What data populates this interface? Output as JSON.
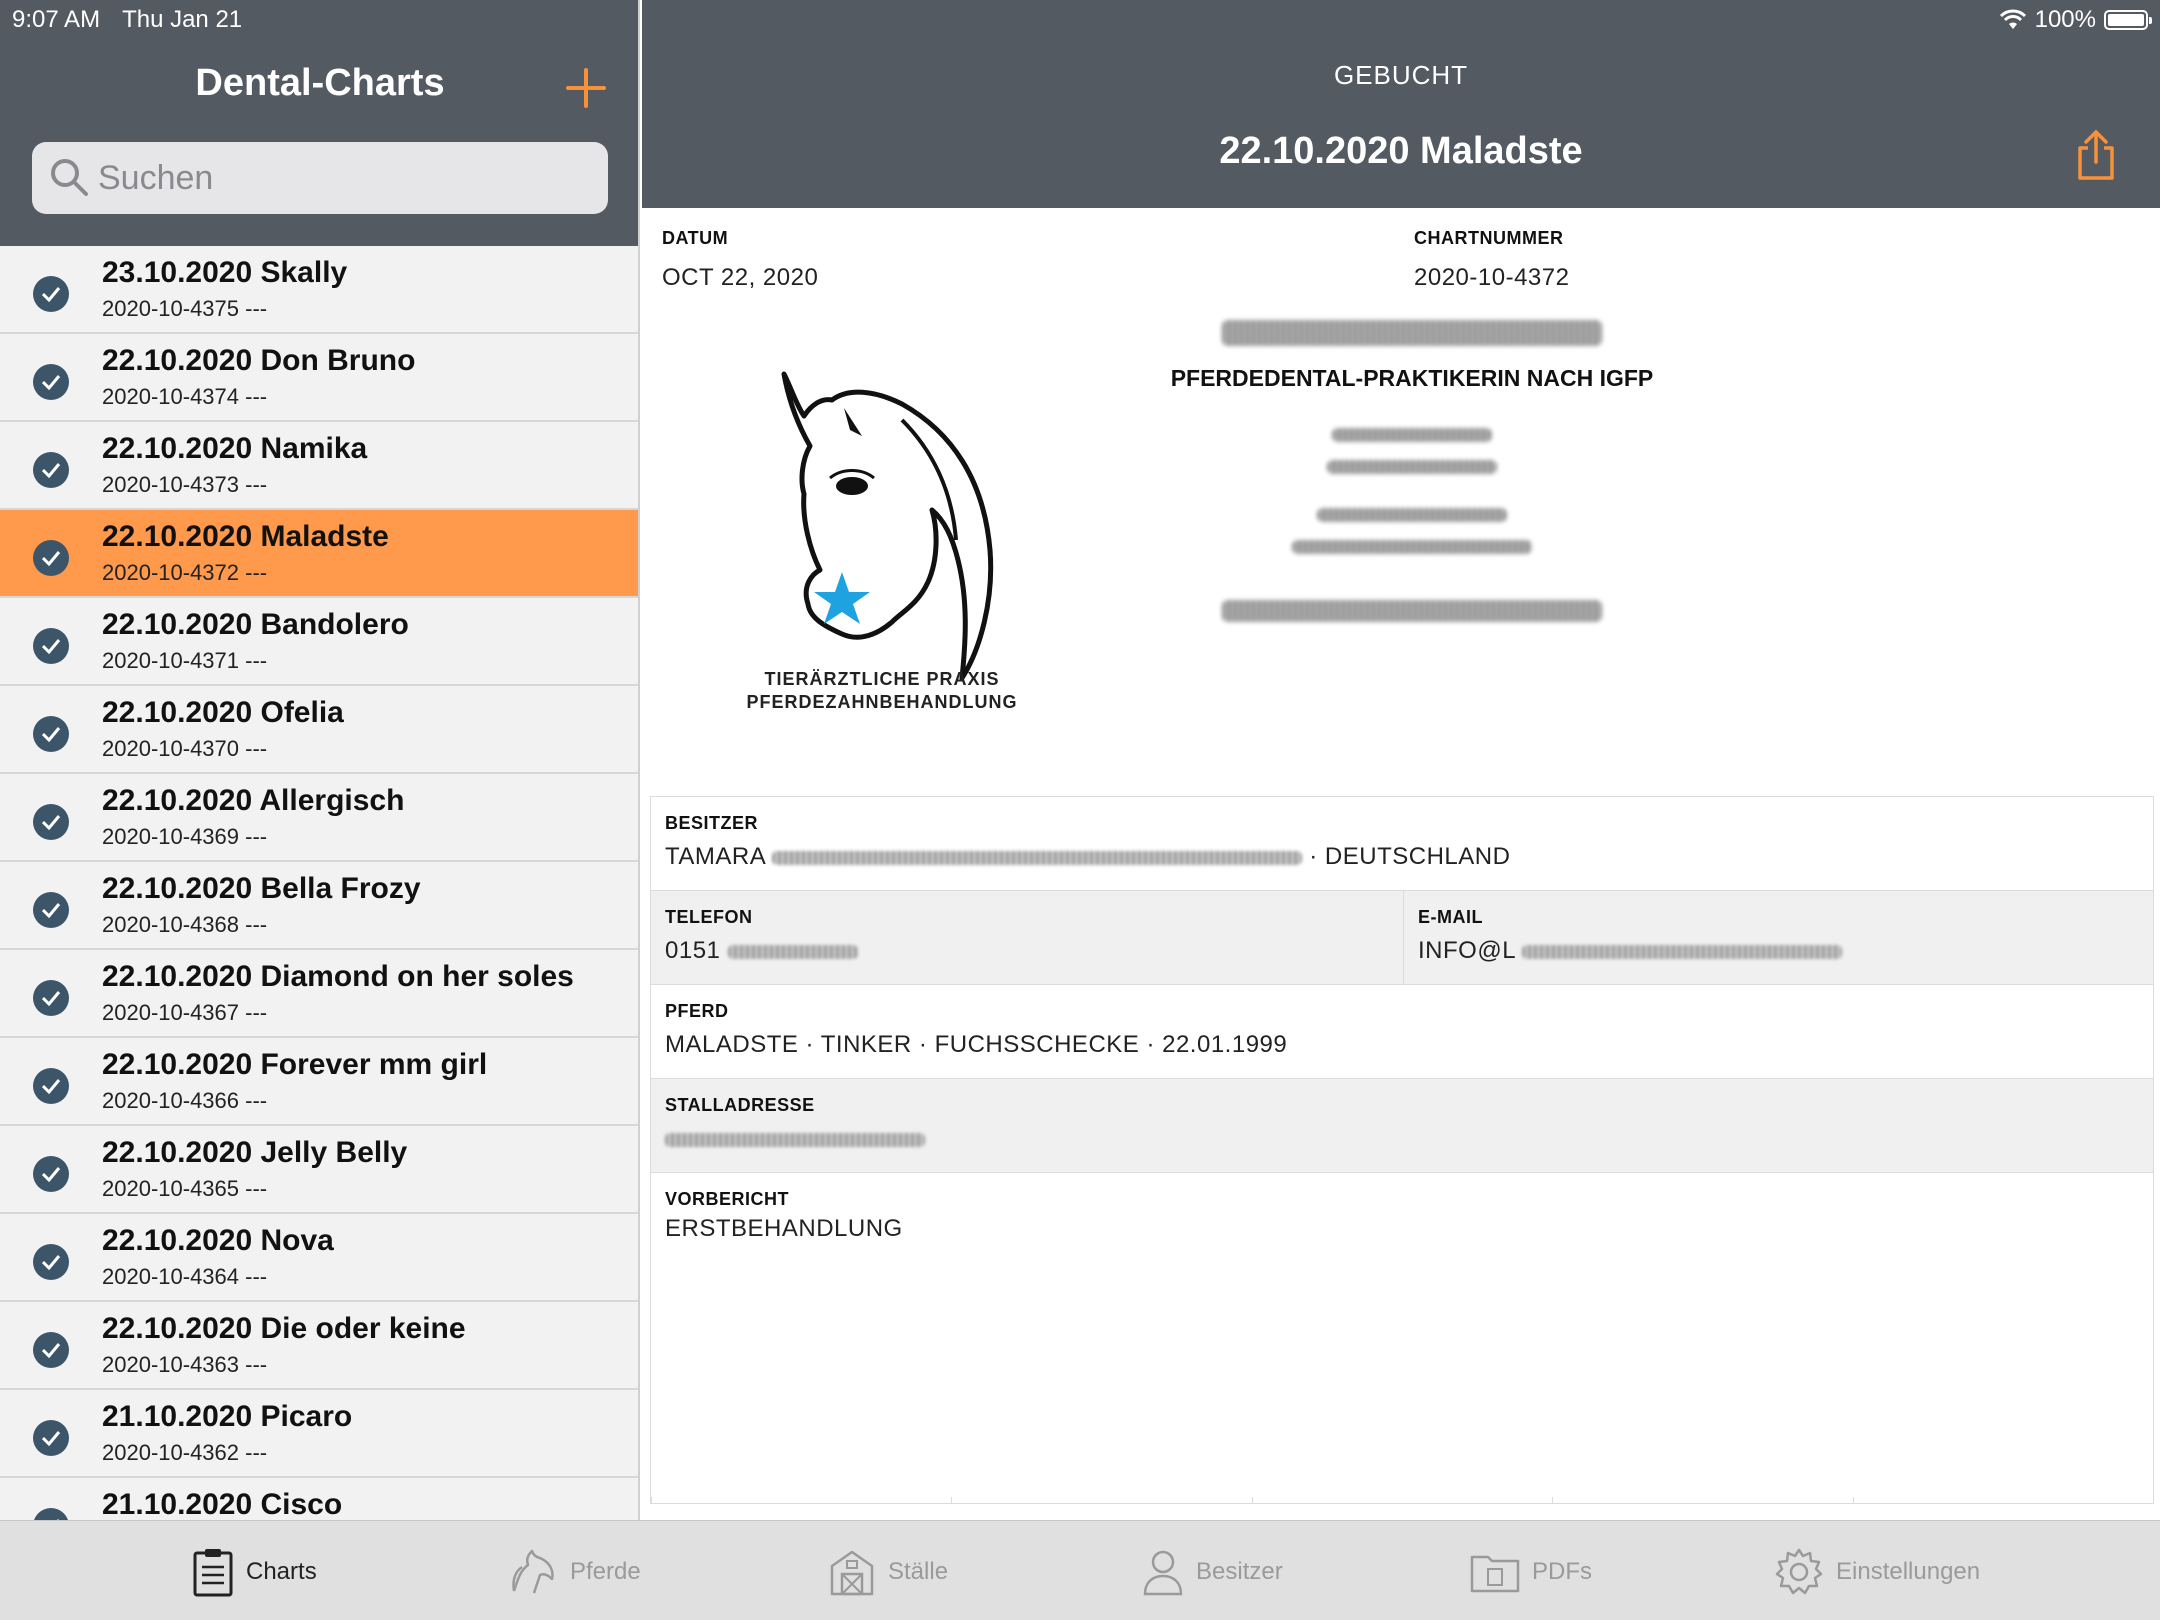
{
  "status_bar": {
    "time": "9:07 AM",
    "date": "Thu Jan 21",
    "battery": "100%"
  },
  "sidebar": {
    "title": "Dental-Charts",
    "search_placeholder": "Suchen",
    "items": [
      {
        "title": "23.10.2020 Skally",
        "subtitle": "2020-10-4375 ---"
      },
      {
        "title": "22.10.2020 Don Bruno",
        "subtitle": "2020-10-4374 ---"
      },
      {
        "title": "22.10.2020 Namika",
        "subtitle": "2020-10-4373 ---"
      },
      {
        "title": "22.10.2020 Maladste",
        "subtitle": "2020-10-4372 ---",
        "selected": true
      },
      {
        "title": "22.10.2020 Bandolero",
        "subtitle": "2020-10-4371 ---"
      },
      {
        "title": "22.10.2020 Ofelia",
        "subtitle": "2020-10-4370 ---"
      },
      {
        "title": "22.10.2020 Allergisch",
        "subtitle": "2020-10-4369 ---"
      },
      {
        "title": "22.10.2020 Bella Frozy",
        "subtitle": "2020-10-4368 ---"
      },
      {
        "title": "22.10.2020 Diamond on her soles",
        "subtitle": "2020-10-4367 ---"
      },
      {
        "title": "22.10.2020 Forever mm girl",
        "subtitle": "2020-10-4366 ---"
      },
      {
        "title": "22.10.2020 Jelly Belly",
        "subtitle": "2020-10-4365 ---"
      },
      {
        "title": "22.10.2020 Nova",
        "subtitle": "2020-10-4364 ---"
      },
      {
        "title": "22.10.2020 Die oder keine",
        "subtitle": "2020-10-4363 ---"
      },
      {
        "title": "21.10.2020 Picaro",
        "subtitle": "2020-10-4362 ---"
      },
      {
        "title": "21.10.2020 Cisco",
        "subtitle": ""
      }
    ]
  },
  "detail": {
    "status": "GEBUCHT",
    "title": "22.10.2020 Maladste",
    "datum_label": "DATUM",
    "datum_value": "OCT 22, 2020",
    "chartnummer_label": "CHARTNUMMER",
    "chartnummer_value": "2020-10-4372",
    "logo_text_line1": "TIERÄRZTLICHE PRAXIS",
    "logo_text_line2": "PFERDEZAHNBEHANDLUNG",
    "practitioner_title": "PFERDEDENTAL-PRAKTIKERIN NACH IGFP",
    "besitzer_label": "BESITZER",
    "besitzer_value_start": "TAMARA",
    "besitzer_value_end": "· DEUTSCHLAND",
    "telefon_label": "TELEFON",
    "telefon_value": "0151",
    "email_label": "E-MAIL",
    "email_value": "INFO@L",
    "pferd_label": "PFERD",
    "pferd_value": "MALADSTE · TINKER · FUCHSSCHECKE · 22.01.1999",
    "stalladresse_label": "STALLADRESSE",
    "vorbericht_label": "VORBERICHT",
    "vorbericht_value": "ERSTBEHANDLUNG"
  },
  "tabs": [
    {
      "label": "Charts",
      "icon": "clipboard-icon",
      "active": true
    },
    {
      "label": "Pferde",
      "icon": "horse-icon"
    },
    {
      "label": "Ställe",
      "icon": "barn-icon"
    },
    {
      "label": "Besitzer",
      "icon": "person-icon"
    },
    {
      "label": "PDFs",
      "icon": "folder-icon"
    },
    {
      "label": "Einstellungen",
      "icon": "gear-icon"
    }
  ],
  "colors": {
    "accent": "#ff994c",
    "header": "#545a62",
    "check": "#3d5568"
  }
}
